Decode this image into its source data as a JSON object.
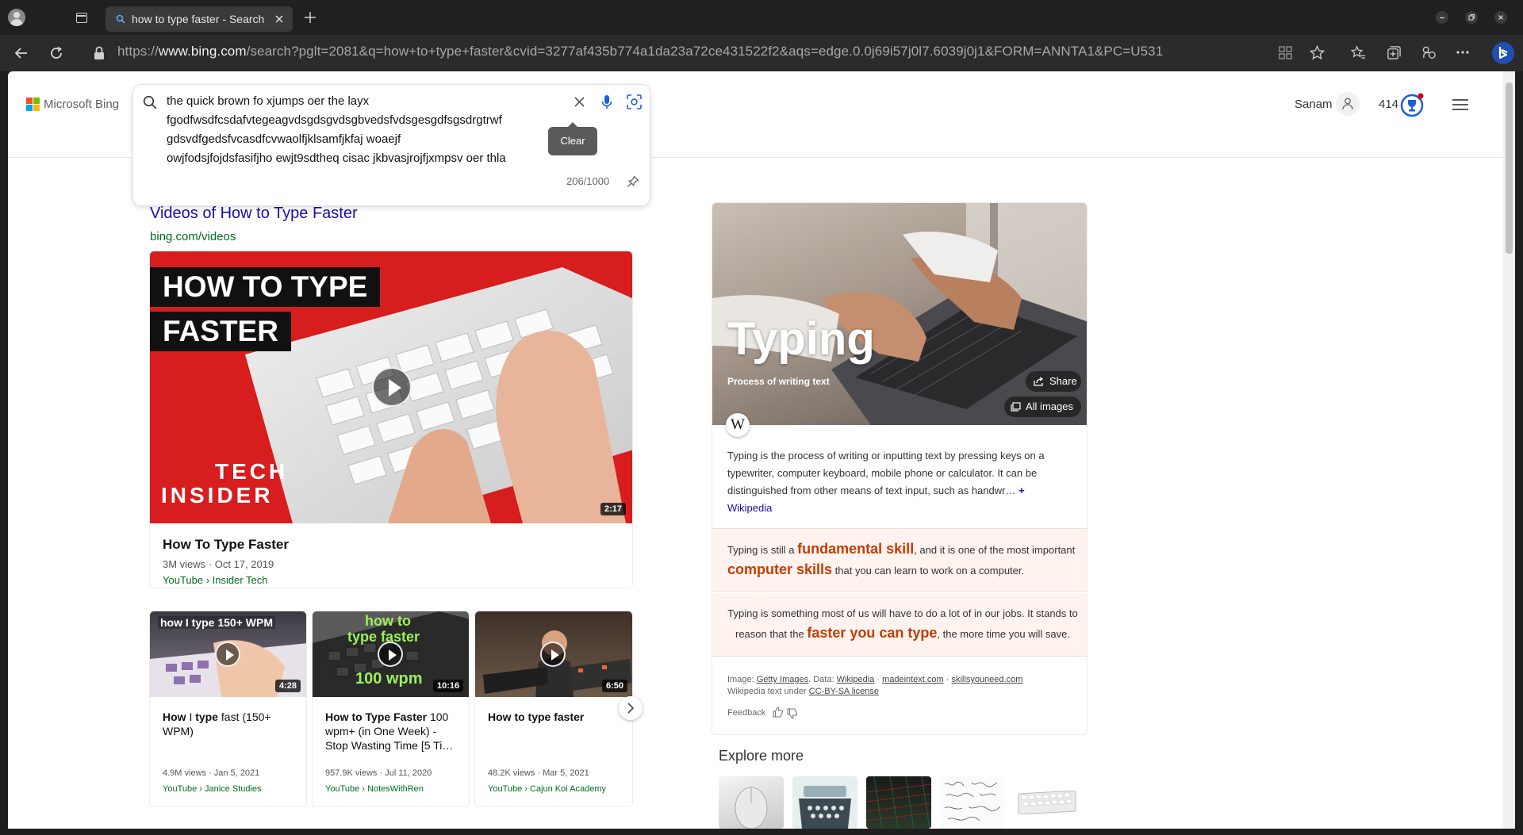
{
  "browser": {
    "tab_title": "how to type faster - Search",
    "url_prefix": "https://",
    "url_domain": "www.bing.com",
    "url_rest": "/search?pglt=2081&q=how+to+type+faster&cvid=3277af435b774a1da23a72ce431522f2&aqs=edge.0.0j69i57j0l7.6039j0j1&FORM=ANNTA1&PC=U531"
  },
  "header": {
    "logo_text": "Microsoft Bing",
    "user_name": "Sanam",
    "rewards_points": "414"
  },
  "search": {
    "query_lines": [
      "the quick brown fo xjumps oer the layx",
      "fgodfwsdfcsdafvtegeagvdsgdsgvdsgbvedsfvdsgesgdfsgsdrgtrwf",
      "gdsvdfgedsfvcasdfcvwaolfjklsamfjkfaj woaejf",
      "owjfodsjfojdsfasifjho ewjt9sdtheq cisac jkbvasjrojfjxmpsv oer thla"
    ],
    "char_count": "206/1000",
    "clear_tooltip": "Clear"
  },
  "videos": {
    "heading": "Videos of How to Type Faster",
    "source": "bing.com/videos",
    "main": {
      "thumb_line1": "HOW TO TYPE",
      "thumb_line2": "FASTER",
      "thumb_brand1": "TECH",
      "thumb_brand2": "INSIDER",
      "duration": "2:17",
      "title": "How To Type Faster",
      "meta": "3M views · Oct 17, 2019",
      "source": "YouTube › Insider Tech"
    },
    "items": [
      {
        "overlay": "how I type 150+ WPM",
        "duration": "4:28",
        "title_bold1": "How",
        "title_mid": " I ",
        "title_bold2": "type",
        "title_rest": " fast (150+ WPM)",
        "meta": "4.9M views · Jan 5, 2021",
        "source": "YouTube › Janice Studies"
      },
      {
        "overlay1": "how to",
        "overlay2": "type faster",
        "overlay3": "100 wpm",
        "duration": "10:16",
        "title_bold": "How to Type Faster",
        "title_rest": " 100 wpm+ (in One Week) - Stop Wasting Time [5 Ti…",
        "meta": "957.9K views · Jul 11, 2020",
        "source": "YouTube › NotesWithRen"
      },
      {
        "duration": "6:50",
        "title_bold": "How to type faster",
        "meta": "48.2K views · Mar 5, 2021",
        "source": "YouTube › Cajun Koi Academy"
      }
    ]
  },
  "knowledge": {
    "title": "Typing",
    "subtitle": "Process of writing text",
    "share_label": "Share",
    "all_images_label": "All images",
    "description": "Typing is the process of writing or inputting text by pressing keys on a typewriter, computer keyboard, mobile phone or calculator. It can be distinguished from other means of text input, such as handwr…",
    "more_symbol": "+",
    "source_link": "Wikipedia",
    "fact1": {
      "pre": "Typing is still a ",
      "hl1": "fundamental skill",
      "mid": ", and it is one of the most important ",
      "hl2": "computer skills",
      "post": " that you can learn to work on a computer."
    },
    "fact2": {
      "pre": "Typing is something most of us will have to do a lot of in our jobs. It stands to reason that the ",
      "hl": "faster you can type",
      "post": ", the more time you will save."
    },
    "credits": {
      "image_label": "Image: ",
      "image_src": "Getty Images",
      "data_label": ". Data: ",
      "data1": "Wikipedia",
      "sep": " · ",
      "data2": "madeintext.com",
      "data3": "skillsyouneed.com",
      "license_text": "Wikipedia text under ",
      "license": "CC-BY-SA license"
    },
    "feedback": "Feedback"
  },
  "explore": {
    "heading": "Explore more"
  },
  "colors": {
    "link": "#1a0dab",
    "url_green": "#006d21",
    "highlight": "#c43d00",
    "rewards_blue": "#1a5fd8"
  }
}
